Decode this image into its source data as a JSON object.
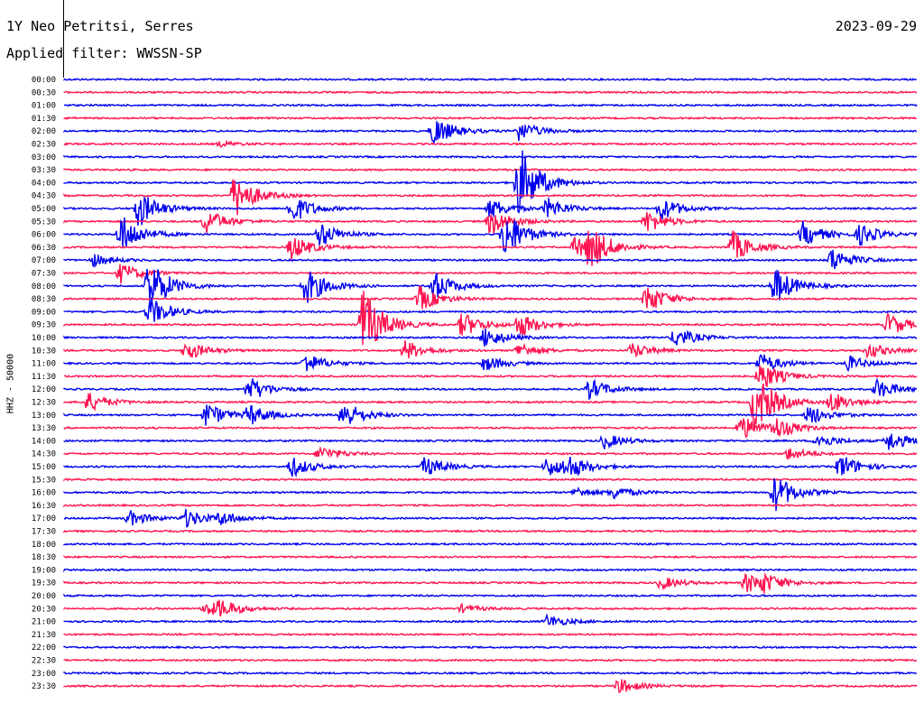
{
  "header": {
    "station": "1Y Neo Petritsi, Serres",
    "date": "2023-09-29",
    "filter": "Applied filter: WWSSN-SP"
  },
  "chart_data": {
    "type": "line",
    "subtype": "helicorder",
    "ylabel": "HHZ - 50000",
    "row_labels": [
      "00:00",
      "00:30",
      "01:00",
      "01:30",
      "02:00",
      "02:30",
      "03:00",
      "03:30",
      "04:00",
      "04:30",
      "05:00",
      "05:30",
      "06:00",
      "06:30",
      "07:00",
      "07:30",
      "08:00",
      "08:30",
      "09:00",
      "09:30",
      "10:00",
      "10:30",
      "11:00",
      "11:30",
      "12:00",
      "12:30",
      "13:00",
      "13:30",
      "14:00",
      "14:30",
      "15:00",
      "15:30",
      "16:00",
      "16:30",
      "17:00",
      "17:30",
      "18:00",
      "18:30",
      "19:00",
      "19:30",
      "20:00",
      "20:30",
      "21:00",
      "21:30",
      "22:00",
      "22:30",
      "23:00",
      "23:30"
    ],
    "trace_colors": [
      "#0000ee",
      "#ff1450"
    ],
    "line_minutes": 30,
    "events": [
      {
        "row": 4,
        "minute": 13,
        "amp": 1.2
      },
      {
        "row": 4,
        "minute": 16,
        "amp": 0.8
      },
      {
        "row": 5,
        "minute": 5.5,
        "amp": 0.2
      },
      {
        "row": 8,
        "minute": 16,
        "amp": 3.0
      },
      {
        "row": 9,
        "minute": 6,
        "amp": 1.8
      },
      {
        "row": 10,
        "minute": 2.6,
        "amp": 1.5
      },
      {
        "row": 10,
        "minute": 8,
        "amp": 1.2
      },
      {
        "row": 10,
        "minute": 15,
        "amp": 0.8
      },
      {
        "row": 10,
        "minute": 17,
        "amp": 0.8
      },
      {
        "row": 10,
        "minute": 21,
        "amp": 0.9
      },
      {
        "row": 11,
        "minute": 5,
        "amp": 1.0
      },
      {
        "row": 11,
        "minute": 15,
        "amp": 1.1
      },
      {
        "row": 11,
        "minute": 20.5,
        "amp": 0.9
      },
      {
        "row": 12,
        "minute": 2,
        "amp": 1.6
      },
      {
        "row": 12,
        "minute": 9,
        "amp": 1.0
      },
      {
        "row": 12,
        "minute": 15.5,
        "amp": 2.0
      },
      {
        "row": 12,
        "minute": 26,
        "amp": 1.0
      },
      {
        "row": 12,
        "minute": 28,
        "amp": 0.8
      },
      {
        "row": 13,
        "minute": 8,
        "amp": 1.0
      },
      {
        "row": 13,
        "minute": 18,
        "amp": 0.9
      },
      {
        "row": 13,
        "minute": 18.5,
        "amp": 1.5
      },
      {
        "row": 13,
        "minute": 23.5,
        "amp": 1.3
      },
      {
        "row": 14,
        "minute": 1,
        "amp": 0.5
      },
      {
        "row": 14,
        "minute": 27,
        "amp": 1.0
      },
      {
        "row": 15,
        "minute": 2,
        "amp": 0.8
      },
      {
        "row": 16,
        "minute": 3,
        "amp": 2.2
      },
      {
        "row": 16,
        "minute": 8.5,
        "amp": 1.5
      },
      {
        "row": 16,
        "minute": 13,
        "amp": 1.2
      },
      {
        "row": 16,
        "minute": 25,
        "amp": 1.5
      },
      {
        "row": 17,
        "minute": 12.5,
        "amp": 1.0
      },
      {
        "row": 17,
        "minute": 20.5,
        "amp": 1.2
      },
      {
        "row": 18,
        "minute": 3,
        "amp": 1.2
      },
      {
        "row": 19,
        "minute": 10.5,
        "amp": 3.0
      },
      {
        "row": 19,
        "minute": 14,
        "amp": 1.0
      },
      {
        "row": 19,
        "minute": 16,
        "amp": 1.0
      },
      {
        "row": 19,
        "minute": 29,
        "amp": 0.9
      },
      {
        "row": 20,
        "minute": 14.8,
        "amp": 0.8
      },
      {
        "row": 20,
        "minute": 21.5,
        "amp": 0.8
      },
      {
        "row": 21,
        "minute": 4.3,
        "amp": 0.8
      },
      {
        "row": 21,
        "minute": 12,
        "amp": 0.8
      },
      {
        "row": 21,
        "minute": 16,
        "amp": 0.6
      },
      {
        "row": 21,
        "minute": 20,
        "amp": 0.6
      },
      {
        "row": 21,
        "minute": 28.3,
        "amp": 0.6
      },
      {
        "row": 22,
        "minute": 8.5,
        "amp": 0.8
      },
      {
        "row": 22,
        "minute": 14.8,
        "amp": 0.6
      },
      {
        "row": 22,
        "minute": 24.5,
        "amp": 0.8
      },
      {
        "row": 22,
        "minute": 27.6,
        "amp": 0.6
      },
      {
        "row": 23,
        "minute": 24.5,
        "amp": 1.2
      },
      {
        "row": 24,
        "minute": 6.5,
        "amp": 1.0
      },
      {
        "row": 24,
        "minute": 18.5,
        "amp": 0.8
      },
      {
        "row": 24,
        "minute": 28.6,
        "amp": 0.8
      },
      {
        "row": 25,
        "minute": 0.8,
        "amp": 0.8
      },
      {
        "row": 25,
        "minute": 24.3,
        "amp": 2.5
      },
      {
        "row": 25,
        "minute": 27,
        "amp": 0.8
      },
      {
        "row": 26,
        "minute": 5,
        "amp": 1.0
      },
      {
        "row": 26,
        "minute": 6.5,
        "amp": 0.8
      },
      {
        "row": 26,
        "minute": 9.8,
        "amp": 1.2
      },
      {
        "row": 26,
        "minute": 26.2,
        "amp": 0.8
      },
      {
        "row": 27,
        "minute": 23.8,
        "amp": 1.0
      },
      {
        "row": 27,
        "minute": 25,
        "amp": 0.8
      },
      {
        "row": 28,
        "minute": 19,
        "amp": 0.6
      },
      {
        "row": 28,
        "minute": 26.5,
        "amp": 0.6
      },
      {
        "row": 28,
        "minute": 29,
        "amp": 0.8
      },
      {
        "row": 29,
        "minute": 9,
        "amp": 0.6
      },
      {
        "row": 29,
        "minute": 25.5,
        "amp": 0.5
      },
      {
        "row": 30,
        "minute": 8,
        "amp": 0.8
      },
      {
        "row": 30,
        "minute": 12.7,
        "amp": 0.8
      },
      {
        "row": 30,
        "minute": 17,
        "amp": 0.8
      },
      {
        "row": 30,
        "minute": 17.7,
        "amp": 0.8
      },
      {
        "row": 30,
        "minute": 27.3,
        "amp": 1.0
      },
      {
        "row": 32,
        "minute": 18,
        "amp": 0.4
      },
      {
        "row": 32,
        "minute": 19.3,
        "amp": 0.5
      },
      {
        "row": 32,
        "minute": 25,
        "amp": 1.5
      },
      {
        "row": 34,
        "minute": 2.3,
        "amp": 0.6
      },
      {
        "row": 34,
        "minute": 4.3,
        "amp": 0.7
      },
      {
        "row": 34,
        "minute": 5.5,
        "amp": 0.5
      },
      {
        "row": 39,
        "minute": 21,
        "amp": 0.5
      },
      {
        "row": 39,
        "minute": 24,
        "amp": 0.8
      },
      {
        "row": 39,
        "minute": 24.6,
        "amp": 0.6
      },
      {
        "row": 41,
        "minute": 5,
        "amp": 0.6
      },
      {
        "row": 41,
        "minute": 5.5,
        "amp": 0.5
      },
      {
        "row": 41,
        "minute": 14,
        "amp": 0.3
      },
      {
        "row": 42,
        "minute": 17,
        "amp": 0.5
      },
      {
        "row": 47,
        "minute": 19.5,
        "amp": 0.6
      }
    ]
  }
}
